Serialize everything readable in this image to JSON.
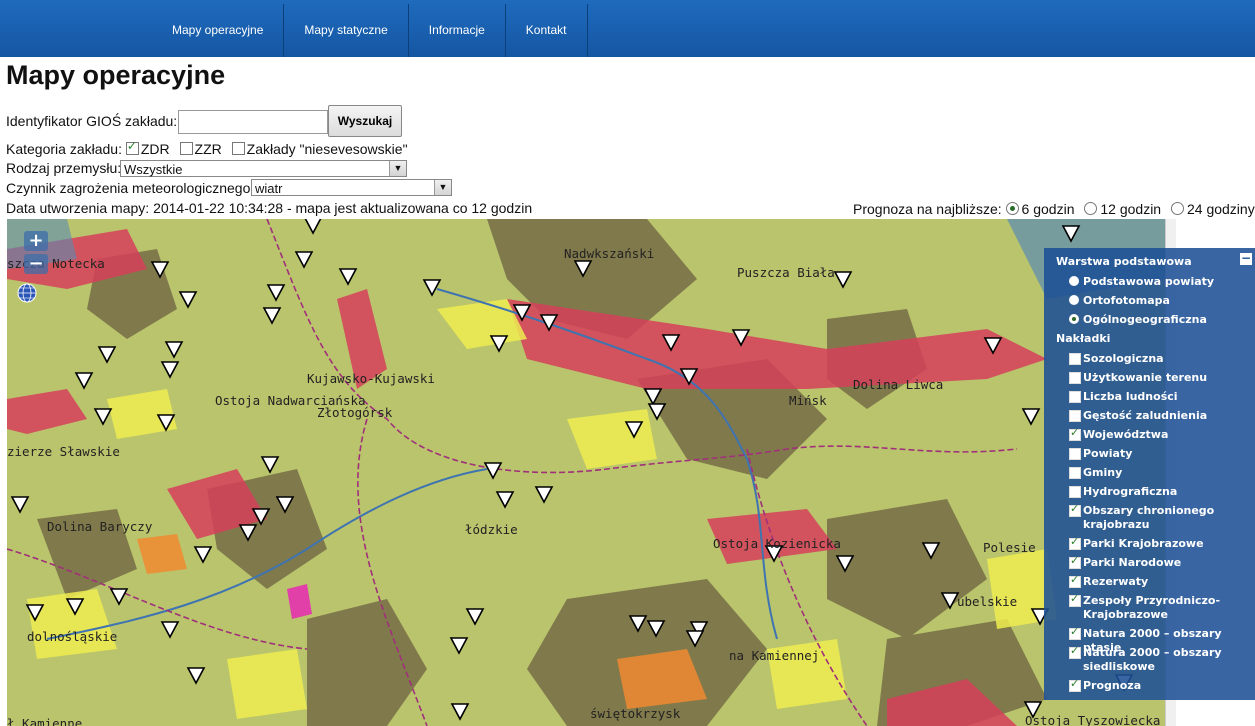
{
  "nav": [
    "Mapy operacyjne",
    "Mapy statyczne",
    "Informacje",
    "Kontakt"
  ],
  "page_title": "Mapy operacyjne",
  "search": {
    "label": "Identyfikator GIOŚ zakładu:",
    "value": "",
    "button": "Wyszukaj"
  },
  "category": {
    "label": "Kategoria zakładu:",
    "options": [
      {
        "label": "ZDR",
        "checked": true
      },
      {
        "label": "ZZR",
        "checked": false
      },
      {
        "label": "Zakłady \"niesevesowskie\"",
        "checked": false
      }
    ]
  },
  "industry": {
    "label": "Rodzaj przemysłu:",
    "value": "Wszystkie"
  },
  "hazard": {
    "label": "Czynnik zagrożenia meteorologicznego:",
    "value": "wiatr"
  },
  "date_info": "Data utworzenia mapy: 2014-01-22 10:34:28 - mapa jest aktualizowana co 12 godzin",
  "forecast": {
    "label": "Prognoza na najbliższe:",
    "options": [
      {
        "label": "6 godzin",
        "selected": true
      },
      {
        "label": "12 godzin",
        "selected": false
      },
      {
        "label": "24 godziny",
        "selected": false
      }
    ]
  },
  "map_controls": {
    "zoom_in": "+",
    "zoom_out": "−"
  },
  "map_labels": [
    "szczа Notecka",
    "Nadwkszański",
    "Puszcza Biała",
    "Dolina Liwca",
    "Mińsk",
    "Ostoja Nadwarciańska",
    "Złotogórsk",
    "Kujawsko-Kujawski",
    "zierze Sławskie",
    "Dolina Baryczy",
    "łódzkie",
    "Ostoja Kozienicka",
    "Polesie",
    "dolnośląskie",
    "na Kamiennej",
    "ubelskie",
    "świętokrzysk",
    "Ostoja Tyszowiecka",
    "ł Kamienne"
  ],
  "layers_panel": {
    "base_title": "Warstwa podstawowa",
    "base_layers": [
      {
        "label": "Podstawowa powiaty",
        "selected": false
      },
      {
        "label": "Ortofotomapa",
        "selected": false
      },
      {
        "label": "Ogólnogeograficzna",
        "selected": true
      }
    ],
    "overlay_title": "Nakładki",
    "overlays": [
      {
        "label": "Sozologiczna",
        "checked": false
      },
      {
        "label": "Użytkowanie terenu",
        "checked": false
      },
      {
        "label": "Liczba ludności",
        "checked": false
      },
      {
        "label": "Gęstość zaludnienia",
        "checked": false
      },
      {
        "label": "Województwa",
        "checked": true
      },
      {
        "label": "Powiaty",
        "checked": false
      },
      {
        "label": "Gminy",
        "checked": false
      },
      {
        "label": "Hydrograficzna",
        "checked": false
      },
      {
        "label": "Obszary chronionego krajobrazu",
        "checked": true
      },
      {
        "label": "Parki Krajobrazowe",
        "checked": true
      },
      {
        "label": "Parki Narodowe",
        "checked": true
      },
      {
        "label": "Rezerwaty",
        "checked": true
      },
      {
        "label": "Zespoły Przyrodniczo-Krajobrazowe",
        "checked": true
      },
      {
        "label": "Natura 2000 – obszary ptasie",
        "checked": true
      },
      {
        "label": "Natura 2000 – obszary siedliskowe",
        "checked": true
      },
      {
        "label": "Prognoza",
        "checked": true
      }
    ]
  },
  "colors": {
    "topbar": "#1a62b3",
    "panel": "#1e5096",
    "forest": "#6e6a46",
    "natura": "#d4405a",
    "protected": "#f0ee52"
  }
}
